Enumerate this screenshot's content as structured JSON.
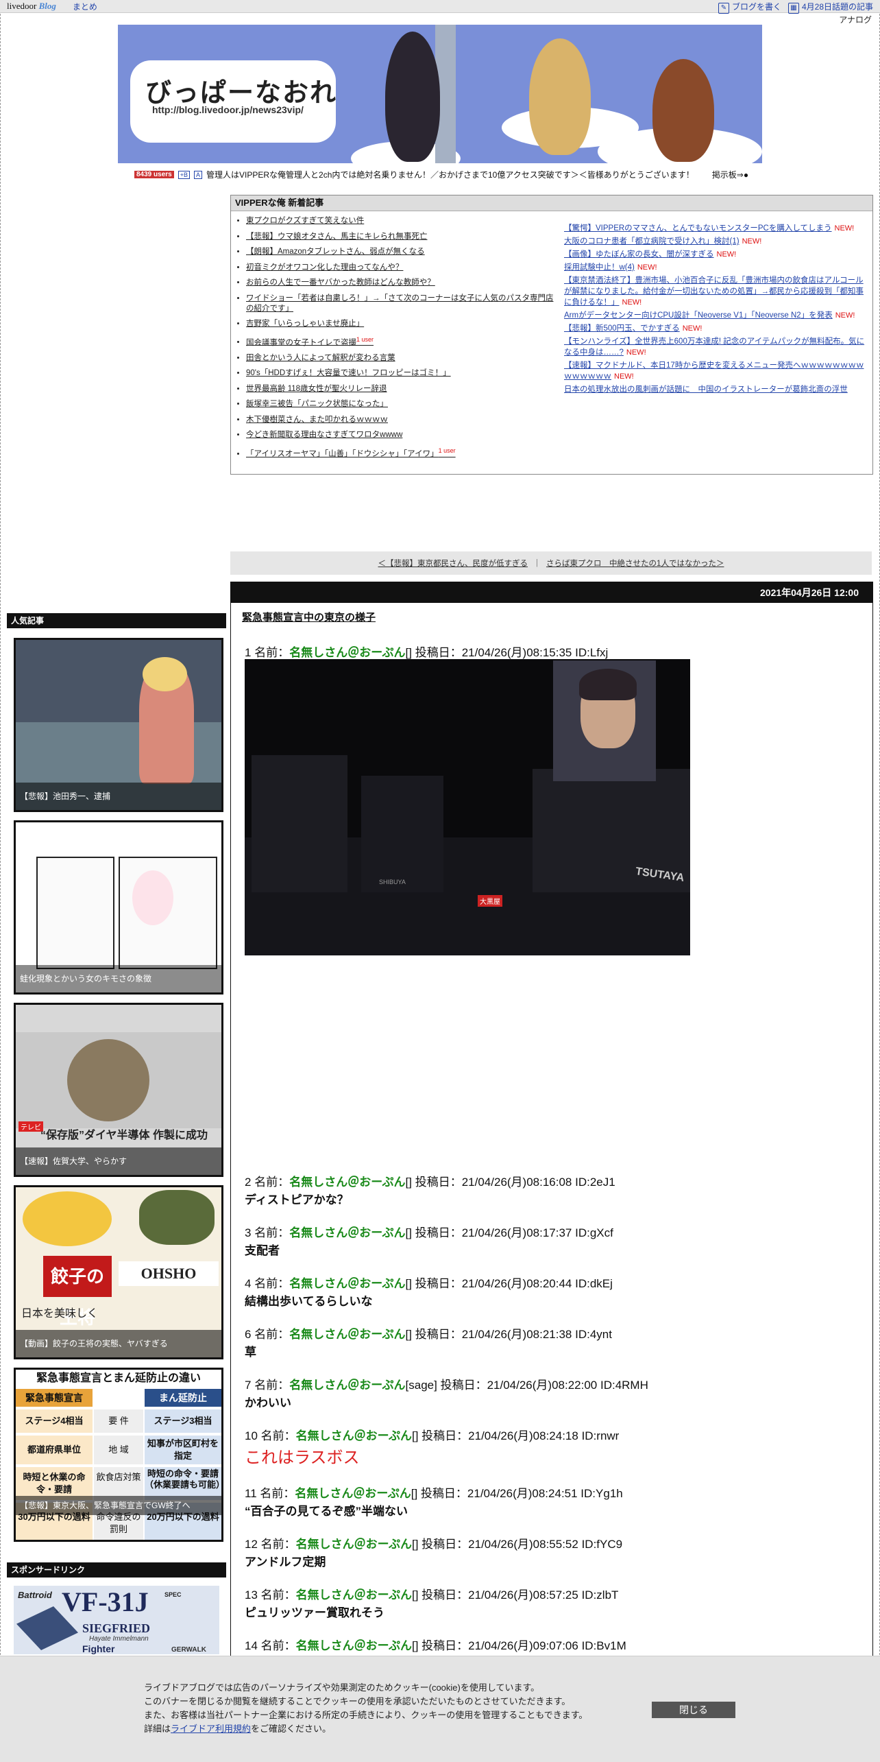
{
  "topbar": {
    "logo_main": "livedoor",
    "logo_blog": "Blog",
    "matome": "まとめ",
    "write_blog": "ブログを書く",
    "popular_today": "4月28日話題の記事",
    "analog": "アナログ"
  },
  "banner": {
    "title": "びっぱーなおれ",
    "url": "http://blog.livedoor.jp/news23vip/"
  },
  "ticker": {
    "users": "8439 users",
    "mini1": "+B",
    "mini2": "A",
    "text": "管理人はVIPPERな俺管理人と2ch内では絶対名乗りません！／おかげさまで10億アクセス突破です＞＜皆様ありがとうございます！",
    "board": "掲示板⇒●"
  },
  "new_articles": {
    "heading": "VIPPERな俺 新着記事",
    "left": [
      {
        "text": "東プクロがクズすぎて笑えない件",
        "badge": ""
      },
      {
        "text": "【悲報】ウマ娘オタさん、馬主にキレられ無事死亡",
        "badge": ""
      },
      {
        "text": "【朗報】Amazonタブレットさん、弱点が無くなる",
        "badge": ""
      },
      {
        "text": "初音ミクがオワコン化した理由ってなんや？",
        "badge": ""
      },
      {
        "text": "お前らの人生で一番ヤバかった教師はどんな教師や？",
        "badge": ""
      },
      {
        "text": "ワイドショー「若者は自粛しろ！」→「さて次のコーナーは女子に人気のパスタ専門店の紹介です」",
        "badge": ""
      },
      {
        "text": "吉野家「いらっしゃいませ廃止」",
        "badge": ""
      },
      {
        "text": "国会議事堂の女子トイレで盗撮",
        "badge": "1 user"
      },
      {
        "text": "田舎とかいう人によって解釈が変わる言葉",
        "badge": ""
      },
      {
        "text": "90's「HDDすげぇ！大容量で速い！フロッピーはゴミ！」",
        "badge": ""
      },
      {
        "text": "世界最高齢 118歳女性が聖火リレー辞退",
        "badge": ""
      },
      {
        "text": "飯塚幸三被告「パニック状態になった」",
        "badge": ""
      },
      {
        "text": "木下優樹菜さん、また叩かれるｗｗｗｗ",
        "badge": ""
      },
      {
        "text": "今どき新聞取る理由なさすぎてワロタwwww",
        "badge": ""
      },
      {
        "text": "「アイリスオーヤマ」「山善」「ドウシシャ」「アイワ」",
        "badge": "1 user"
      }
    ],
    "right": [
      {
        "text": "【驚愕】VIPPERのママさん、とんでもないモンスターPCを購入してしまう",
        "new": "NEW!"
      },
      {
        "text": "大阪のコロナ患者「都立病院で受け入れ」検討(1)",
        "new": "NEW!"
      },
      {
        "text": "【画像】ゆたぼん家の長女、闇が深すぎる",
        "new": "NEW!"
      },
      {
        "text": "採用試験中止！w(4)",
        "new": "NEW!"
      },
      {
        "text": "【東京禁酒法終了】豊洲市場、小池百合子に反乱「豊洲市場内の飲食店はアルコールが解禁になりました。給付金が一切出ないための処置」→都民から応援殺到「都知事に負けるな！」",
        "new": "NEW!"
      },
      {
        "text": "Armがデータセンター向けCPU設計「Neoverse V1」「Neoverse N2」を発表",
        "new": "NEW!"
      },
      {
        "text": "【悲報】新500円玉、でかすぎる",
        "new": "NEW!"
      },
      {
        "text": "【モンハンライズ】全世界売上600万本達成! 記念のアイテムパックが無料配布。気になる中身は……?",
        "new": "NEW!"
      },
      {
        "text": "【速報】マクドナルド、本日17時から歴史を変えるメニュー発売へｗｗｗｗｗｗｗｗｗｗｗｗｗｗ",
        "new": "NEW!"
      },
      {
        "text": "日本の処理水放出の風刺画が話題に　中国のイラストレーターが葛飾北斎の浮世",
        "new": ""
      }
    ]
  },
  "prevnext": {
    "prev": "＜【悲報】東京都民さん、民度が低すぎる",
    "next": "さらば東プクロ　中絶させたの1人ではなかった＞"
  },
  "sidebar": {
    "popular_heading": "人気記事",
    "popular": [
      "【悲報】池田秀一、逮捕",
      "蛙化現象とかいう女のキモさの象徴",
      "【速報】佐賀大学、やらかす",
      "【動画】餃子の王将の実態、ヤバすぎる",
      "【悲報】東京大阪、緊急事態宣言でGW終了へ"
    ],
    "card_texts": {
      "gyoza": "餃子の王将",
      "ohsho": "OHSHO",
      "gyoza_sub": "日本を美味しく",
      "table_title": "緊急事態宣言とまん延防止の違い",
      "table_h1": "緊急事態宣言",
      "table_h2": "まん延防止",
      "row1": [
        "ステージ4相当",
        "要 件",
        "ステージ3相当"
      ],
      "row2": [
        "都道府県単位",
        "地 域",
        "知事が市区町村を指定"
      ],
      "row3": [
        "時短と休業の命令・要請",
        "飲食店対策",
        "時短の命令・要請（休業要請も可能）"
      ],
      "row4": [
        "30万円以下の過料",
        "命令違反の罰則",
        "20万円以下の過料"
      ],
      "saga_tag": "テレビ",
      "saga_text": "“保存版”ダイヤ半導体 作製に成功"
    },
    "sponsor_heading": "スポンサードリンク",
    "sponsor": {
      "brand": "Battroid",
      "model": "VF-31J",
      "name": "SIEGFRIED",
      "pilot": "Hayate Immelmann",
      "type": "Fighter",
      "spec": "SPEC",
      "tail": "GERWALK"
    }
  },
  "article": {
    "date": "2021年04月26日 12:00",
    "title": "緊急事態宣言中の東京の様子",
    "photo_signs": [
      "TSUTAYA",
      "大黒屋",
      "SHIBUYA"
    ],
    "posts": [
      {
        "num": "1",
        "name": "名無しさん＠おーぷん",
        "mail": "[]",
        "date": "投稿日：21/04/26(月)08:15:35 ID:Lfxj",
        "body": ""
      },
      {
        "num": "2",
        "name": "名無しさん＠おーぷん",
        "mail": "[]",
        "date": "投稿日：21/04/26(月)08:16:08 ID:2eJ1",
        "body": "ディストピアかな？"
      },
      {
        "num": "3",
        "name": "名無しさん＠おーぷん",
        "mail": "[]",
        "date": "投稿日：21/04/26(月)08:17:37 ID:gXcf",
        "body": "支配者"
      },
      {
        "num": "4",
        "name": "名無しさん＠おーぷん",
        "mail": "[]",
        "date": "投稿日：21/04/26(月)08:20:44 ID:dkEj",
        "body": "結構出歩いてるらしいな"
      },
      {
        "num": "6",
        "name": "名無しさん＠おーぷん",
        "mail": "[]",
        "date": "投稿日：21/04/26(月)08:21:38 ID:4ynt",
        "body": "草"
      },
      {
        "num": "7",
        "name": "名無しさん＠おーぷん",
        "mail": "[sage]",
        "date": "投稿日：21/04/26(月)08:22:00 ID:4RMH",
        "body": "かわいい"
      },
      {
        "num": "10",
        "name": "名無しさん＠おーぷん",
        "mail": "[]",
        "date": "投稿日：21/04/26(月)08:24:18 ID:rnwr",
        "body": "これはラスボス"
      },
      {
        "num": "11",
        "name": "名無しさん＠おーぷん",
        "mail": "[]",
        "date": "投稿日：21/04/26(月)08:24:51 ID:Yg1h",
        "body": "“百合子の見てるぞ感”半端ない"
      },
      {
        "num": "12",
        "name": "名無しさん＠おーぷん",
        "mail": "[]",
        "date": "投稿日：21/04/26(月)08:55:52 ID:fYC9",
        "body": "アンドルフ定期"
      },
      {
        "num": "13",
        "name": "名無しさん＠おーぷん",
        "mail": "[]",
        "date": "投稿日：21/04/26(月)08:57:25 ID:zlbT",
        "body": "ピュリッツァー賞取れそう"
      },
      {
        "num": "14",
        "name": "名無しさん＠おーぷん",
        "mail": "[]",
        "date": "投稿日：21/04/26(月)09:07:06 ID:Bv1M",
        "body": ""
      }
    ],
    "name_label": "名前：",
    "colors": {
      "name": "#1a8a1a",
      "red_text": "#d22"
    }
  },
  "cookie": {
    "line1": "ライブドアブログでは広告のパーソナライズや効果測定のためクッキー(cookie)を使用しています。",
    "line2": "このバナーを閉じるか閲覧を継続することでクッキーの使用を承認いただいたものとさせていただきます。",
    "line3": "また、お客様は当社パートナー企業における所定の手続きにより、クッキーの使用を管理することもできます。",
    "line4_pre": "詳細は",
    "line4_link": "ライブドア利用規約",
    "line4_post": "をご確認ください。",
    "close": "閉じる"
  }
}
